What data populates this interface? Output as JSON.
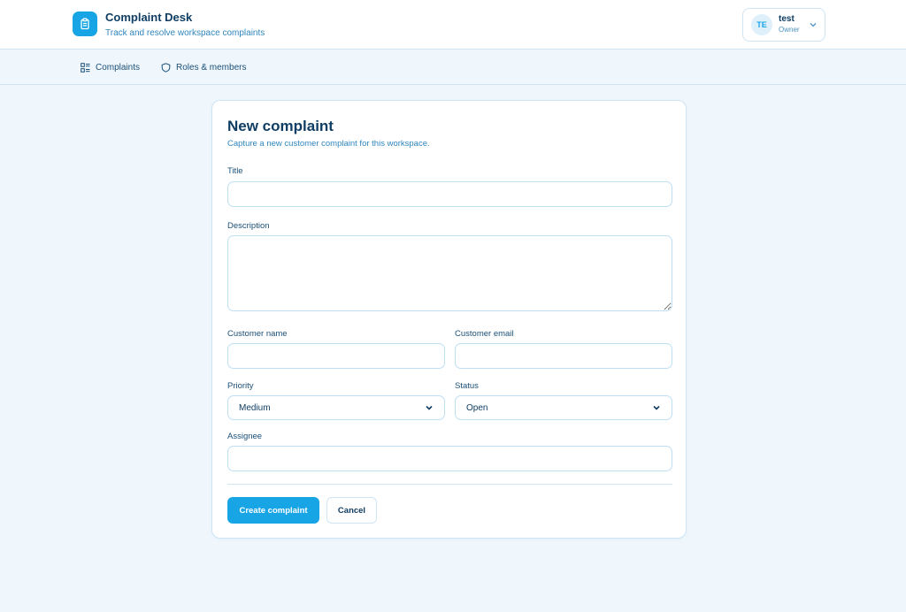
{
  "app": {
    "title": "Complaint Desk",
    "subtitle": "Track and resolve workspace complaints",
    "icon": "clipboard-icon"
  },
  "user": {
    "initials": "TE",
    "name": "test",
    "role": "Owner"
  },
  "nav": {
    "items": [
      {
        "label": "Complaints",
        "icon": "grid-list-icon"
      },
      {
        "label": "Roles & members",
        "icon": "shield-icon"
      }
    ]
  },
  "form": {
    "title": "New complaint",
    "subtitle": "Capture a new customer complaint for this workspace.",
    "fields": {
      "title": {
        "label": "Title",
        "value": ""
      },
      "description": {
        "label": "Description",
        "value": ""
      },
      "customer_name": {
        "label": "Customer name",
        "value": ""
      },
      "customer_email": {
        "label": "Customer email",
        "value": ""
      },
      "priority": {
        "label": "Priority",
        "value": "Medium"
      },
      "status": {
        "label": "Status",
        "value": "Open"
      },
      "assignee": {
        "label": "Assignee",
        "value": ""
      }
    },
    "submit_label": "Create complaint",
    "cancel_label": "Cancel"
  },
  "colors": {
    "accent": "#17a5e6",
    "background": "#eff7fd",
    "text": "#0f3d63",
    "border": "#cfe5f4"
  }
}
